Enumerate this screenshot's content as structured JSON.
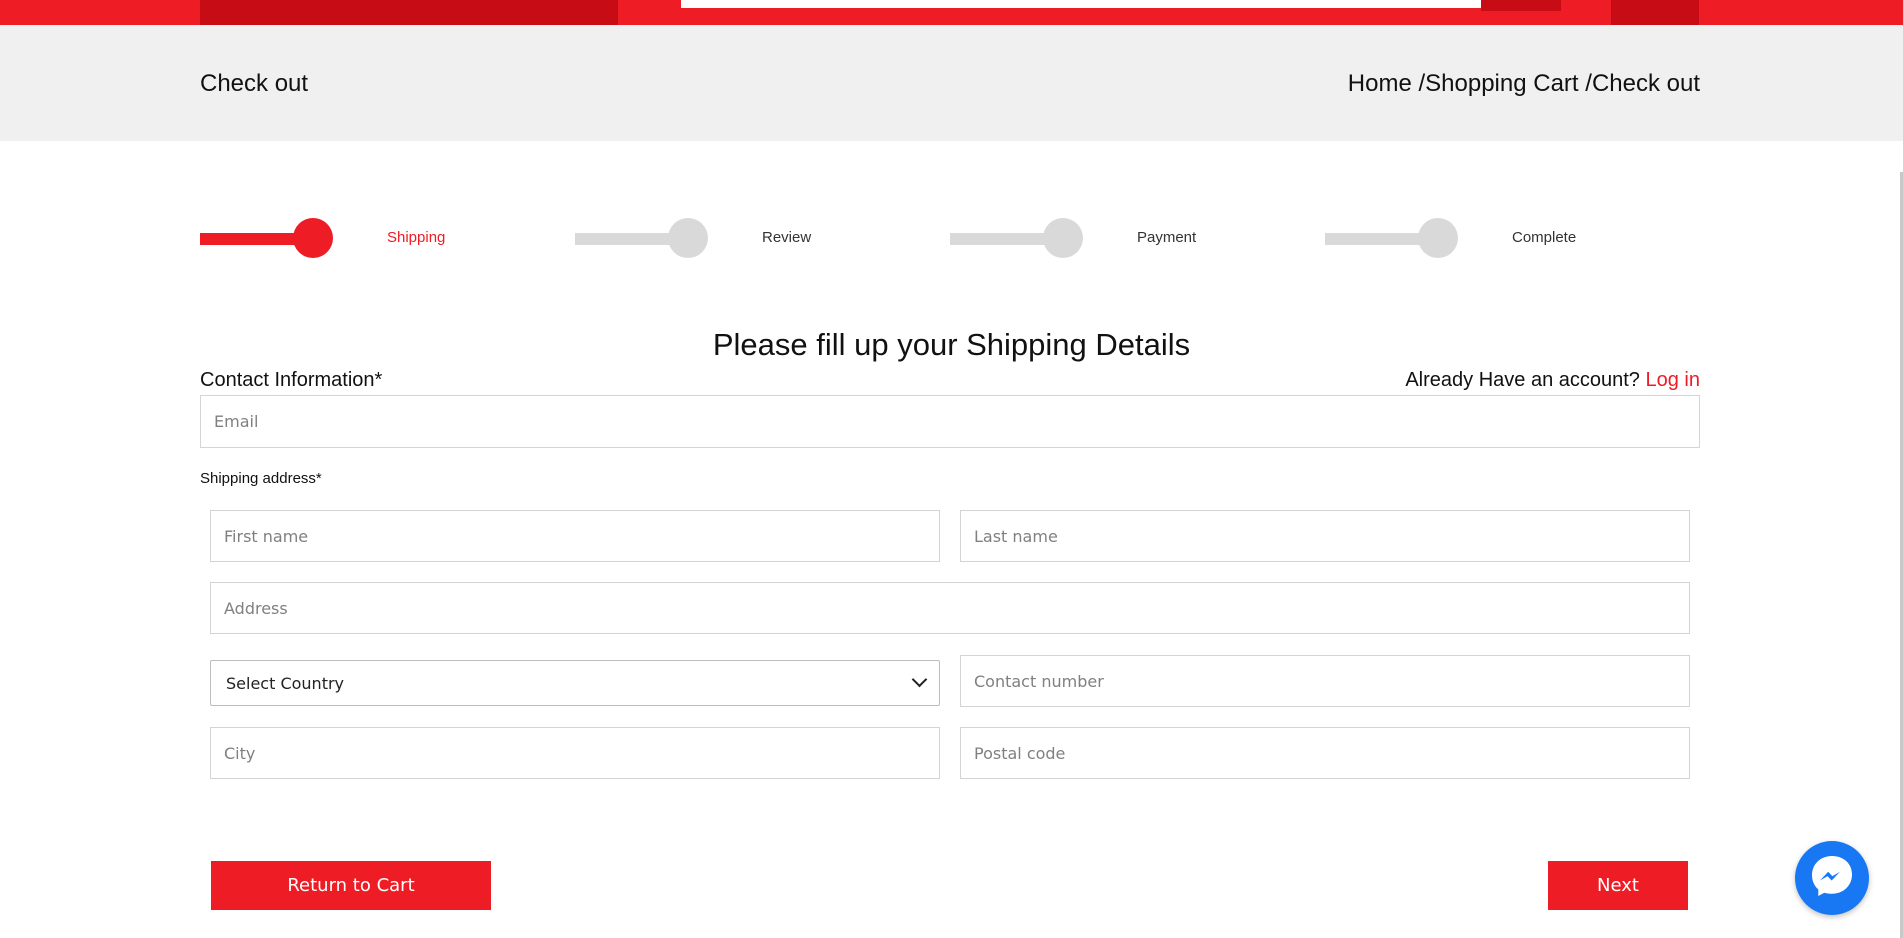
{
  "colors": {
    "accent": "#ee1c25",
    "accent_dark": "#c80c16",
    "band_bg": "#f0f0f0",
    "inactive_step": "#d9d9d9",
    "messenger": "#1877f2"
  },
  "header": {
    "title": "Check out",
    "breadcrumb": [
      "Home /",
      "Shopping Cart /",
      "Check out"
    ]
  },
  "steps": [
    {
      "label": "Shipping",
      "active": true
    },
    {
      "label": "Review",
      "active": false
    },
    {
      "label": "Payment",
      "active": false
    },
    {
      "label": "Complete",
      "active": false
    }
  ],
  "form": {
    "heading": "Please fill up your Shipping Details",
    "contact_label": "Contact Information*",
    "account_prompt": "Already Have an account?",
    "login_link": "Log in",
    "email_placeholder": "Email",
    "shipping_label": "Shipping address*",
    "first_name_placeholder": "First name",
    "last_name_placeholder": "Last name",
    "address_placeholder": "Address",
    "country_selected": "Select Country",
    "contact_number_placeholder": "Contact number",
    "city_placeholder": "City",
    "postal_placeholder": "Postal code"
  },
  "buttons": {
    "return": "Return to Cart",
    "next": "Next"
  },
  "icons": {
    "chat": "messenger-icon",
    "select": "chevron-down-icon"
  }
}
